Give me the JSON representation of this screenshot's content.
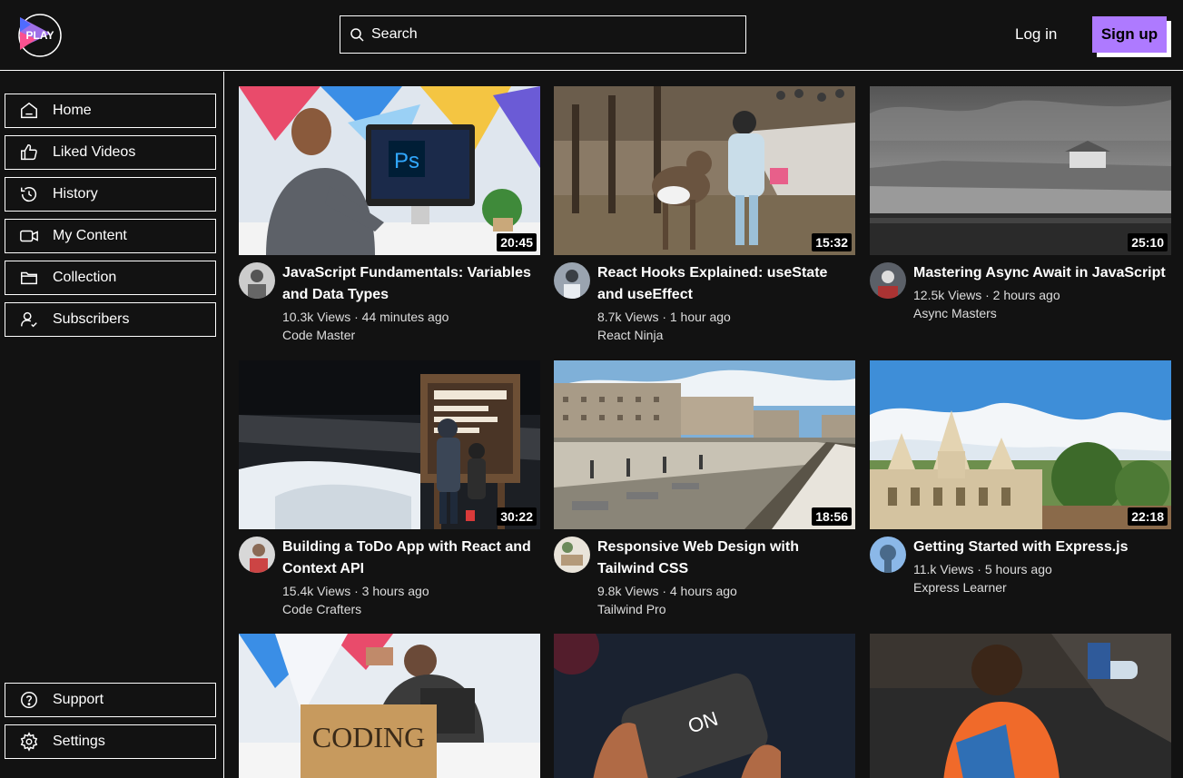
{
  "header": {
    "logo_text": "PLAY",
    "search_placeholder": "Search",
    "login_label": "Log in",
    "signup_label": "Sign up",
    "accent_color": "#ae7aff"
  },
  "sidebar": {
    "items": [
      {
        "label": "Home",
        "icon": "home-icon"
      },
      {
        "label": "Liked Videos",
        "icon": "thumbs-up-icon"
      },
      {
        "label": "History",
        "icon": "history-icon"
      },
      {
        "label": "My Content",
        "icon": "video-camera-icon"
      },
      {
        "label": "Collection",
        "icon": "folder-icon"
      },
      {
        "label": "Subscribers",
        "icon": "user-check-icon"
      }
    ],
    "bottom_items": [
      {
        "label": "Support",
        "icon": "question-circle-icon"
      },
      {
        "label": "Settings",
        "icon": "gear-icon"
      }
    ]
  },
  "videos": [
    {
      "title": "JavaScript Fundamentals: Variables and Data Types",
      "stats": "10.3k Views · 44 minutes ago",
      "channel": "Code Master",
      "duration": "20:45"
    },
    {
      "title": "React Hooks Explained: useState and useEffect",
      "stats": "8.7k Views · 1 hour ago",
      "channel": "React Ninja",
      "duration": "15:32"
    },
    {
      "title": "Mastering Async Await in JavaScript",
      "stats": "12.5k Views · 2 hours ago",
      "channel": "Async Masters",
      "duration": "25:10"
    },
    {
      "title": "Building a ToDo App with React and Context API",
      "stats": "15.4k Views · 3 hours ago",
      "channel": "Code Crafters",
      "duration": "30:22"
    },
    {
      "title": "Responsive Web Design with Tailwind CSS",
      "stats": "9.8k Views · 4 hours ago",
      "channel": "Tailwind Pro",
      "duration": "18:56"
    },
    {
      "title": "Getting Started with Express.js",
      "stats": "11.k Views · 5 hours ago",
      "channel": "Express Learner",
      "duration": "22:18"
    }
  ]
}
